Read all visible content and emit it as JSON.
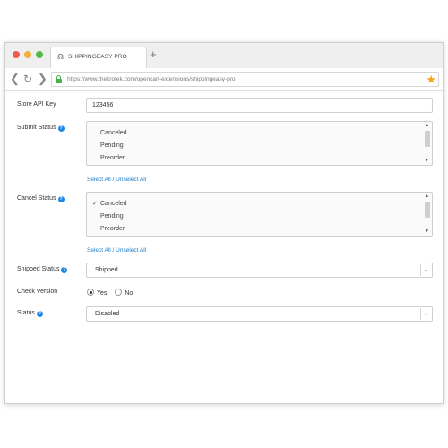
{
  "browser": {
    "tab_title": "SHIPPINGEASY PRO",
    "new_tab_symbol": "+",
    "url": "https://www.thekrotek.com/opencart-extensions/shippingeasy-pro",
    "icons": {
      "tab": "tab-favicon-icon",
      "back": "arrow-left-icon",
      "reload": "reload-icon",
      "forward": "arrow-right-icon",
      "lock": "lock-icon",
      "bookmark": "star-icon"
    },
    "colors": {
      "close": "#f15a4a",
      "minimize": "#f2b134",
      "maximize": "#55b94a",
      "lock": "#4caf50",
      "star": "#f5a623"
    }
  },
  "form": {
    "help_symbol": "?",
    "store_api_key": {
      "label": "Store API Key",
      "value": "123456"
    },
    "submit_status": {
      "label": "Submit Status",
      "options": [
        {
          "label": "Canceled",
          "checked": false
        },
        {
          "label": "Pending",
          "checked": false
        },
        {
          "label": "Preorder",
          "checked": false
        }
      ],
      "select_link": "Select All / Unselect All"
    },
    "cancel_status": {
      "label": "Cancel Status",
      "options": [
        {
          "label": "Canceled",
          "checked": true
        },
        {
          "label": "Pending",
          "checked": false
        },
        {
          "label": "Preorder",
          "checked": false
        }
      ],
      "select_link": "Select All / Unselect All"
    },
    "shipped_status": {
      "label": "Shipped Status",
      "value": "Shipped"
    },
    "check_version": {
      "label": "Check Version",
      "options": [
        "Yes",
        "No"
      ],
      "selected": "Yes"
    },
    "status": {
      "label": "Status",
      "value": "Disabled"
    },
    "check_mark": "✓",
    "colors": {
      "link": "#1e7ec8",
      "help": "#1e88e5"
    }
  }
}
